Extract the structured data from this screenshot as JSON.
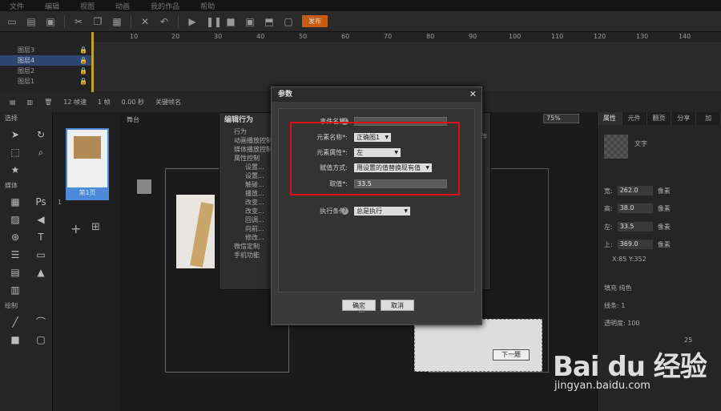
{
  "menu": [
    "文件",
    "编辑",
    "视图",
    "动画",
    "我的作品",
    "帮助"
  ],
  "toolbar": {
    "publish": "发布"
  },
  "timeline": {
    "ticks": [
      "10",
      "20",
      "30",
      "40",
      "50",
      "60",
      "70",
      "80",
      "90",
      "100",
      "110",
      "120",
      "130",
      "140"
    ],
    "layers": [
      "图层3",
      "图层4",
      "图层2",
      "图层1"
    ],
    "status": [
      "12 帧速",
      "1 帧",
      "0.00 秒",
      "关键帧名"
    ]
  },
  "left_panel": {
    "select_head": "选择",
    "media_head": "媒体",
    "draw_head": "绘制"
  },
  "pages": {
    "thumb_caption": "第1页",
    "thumb_number": "1"
  },
  "stage": {
    "tab": "舞台",
    "zoom": "75%",
    "next_button": "下一题"
  },
  "behavior_panel": {
    "title": "编辑行为",
    "tree": [
      "行为",
      "动画播放控制",
      "媒体播放控制",
      "属性控制",
      "设置...",
      "设置...",
      "触碰...",
      "播放...",
      "改变...",
      "改变...",
      "回调...",
      "向前...",
      "修改...",
      "微信定制",
      "手机功能"
    ],
    "list_head": "操作"
  },
  "right_panel": {
    "tabs": [
      "属性",
      "元件",
      "翻页",
      "分享",
      "加"
    ],
    "name": "文字",
    "props": [
      {
        "label": "宽:",
        "value": "262.0",
        "unit": "像素"
      },
      {
        "label": "高:",
        "value": "38.0",
        "unit": "像素"
      },
      {
        "label": "左:",
        "value": "33.5",
        "unit": "像素"
      },
      {
        "label": "上:",
        "value": "369.0",
        "unit": "像素"
      }
    ],
    "xy": "X:85    Y:352",
    "fill": "填充",
    "fill_mode": "纯色",
    "border": "线条:",
    "border_width": "1",
    "opacity": "透明度:",
    "opacity_value": "100",
    "value_25": "25"
  },
  "modal": {
    "title": "参数",
    "event_name_label": "事件名称:",
    "event_name_value": "",
    "element_name_label": "元素名称*:",
    "element_name_value": "正确图1",
    "element_prop_label": "元素属性*:",
    "element_prop_value": "左",
    "assign_mode_label": "赋值方式:",
    "assign_mode_value": "用设置的值替换现有值",
    "value_label": "取值*:",
    "value_value": "33.5",
    "condition_label": "执行条件:",
    "condition_value": "总是执行",
    "ok": "确定",
    "cancel": "取消"
  },
  "watermark": {
    "logo": "Bai du 经验",
    "url": "jingyan.baidu.com"
  }
}
